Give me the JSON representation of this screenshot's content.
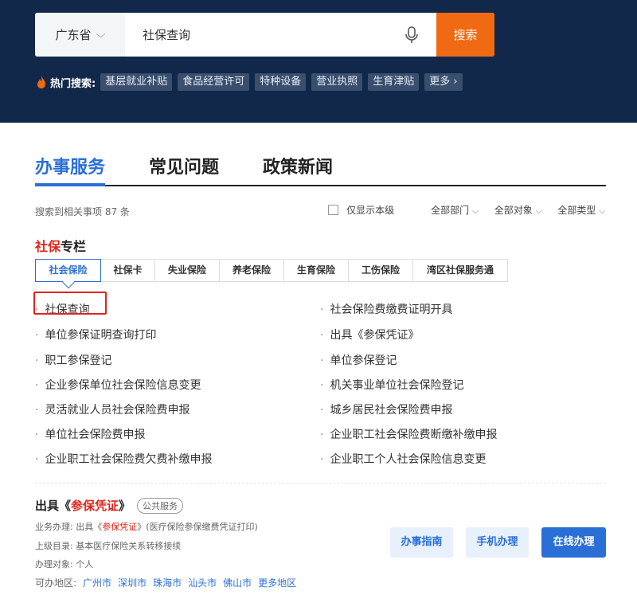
{
  "header": {
    "region": "广东省",
    "search_value": "社保查询",
    "search_button": "搜索",
    "hot_label": "热门搜索:",
    "hot_tags": [
      "基层就业补贴",
      "食品经营许可",
      "特种设备",
      "营业执照",
      "生育津贴",
      "更多 ›"
    ]
  },
  "tabs": [
    "办事服务",
    "常见问题",
    "政策新闻"
  ],
  "filter": {
    "result_count": "搜索到相关事项 87 条",
    "only_this_level": "仅显示本级",
    "dropdowns": [
      "全部部门",
      "全部对象",
      "全部类型"
    ]
  },
  "column": {
    "title_red": "社保",
    "title_rest": "专栏"
  },
  "subtabs": [
    "社会保险",
    "社保卡",
    "失业保险",
    "养老保险",
    "生育保险",
    "工伤保险",
    "湾区社保服务通"
  ],
  "services_left": [
    "社保查询",
    "单位参保证明查询打印",
    "职工参保登记",
    "企业参保单位社会保险信息变更",
    "灵活就业人员社会保险费申报",
    "单位社会保险费申报",
    "企业职工社会保险费欠费补缴申报"
  ],
  "services_right": [
    "社会保险费缴费证明开具",
    "出具《参保凭证》",
    "单位参保登记",
    "机关事业单位社会保险登记",
    "城乡居民社会保险费申报",
    "企业职工社会保险费断缴补缴申报",
    "企业职工个人社会保险信息变更"
  ],
  "detail": {
    "title_pre": "出具《",
    "title_red": "参保凭证",
    "title_post": "》",
    "badge": "公共服务",
    "handle_pre": "业务办理: 出具《",
    "handle_red": "参保凭证",
    "handle_post": "》(医疗保险参保缴费凭证打印)",
    "parent": "上级目录: 基本医疗保险关系转移接续",
    "target": "办理对象: 个人",
    "areas_label": "可办地区:",
    "areas": [
      "广州市",
      "深圳市",
      "珠海市",
      "汕头市",
      "佛山市",
      "更多地区"
    ],
    "buttons": [
      "办事指南",
      "手机办理",
      "在线办理"
    ]
  },
  "colors": {
    "header_bg": "#12284a",
    "accent": "#2a6fd6",
    "search_btn": "#f06a14",
    "highlight": "#e0241b"
  }
}
